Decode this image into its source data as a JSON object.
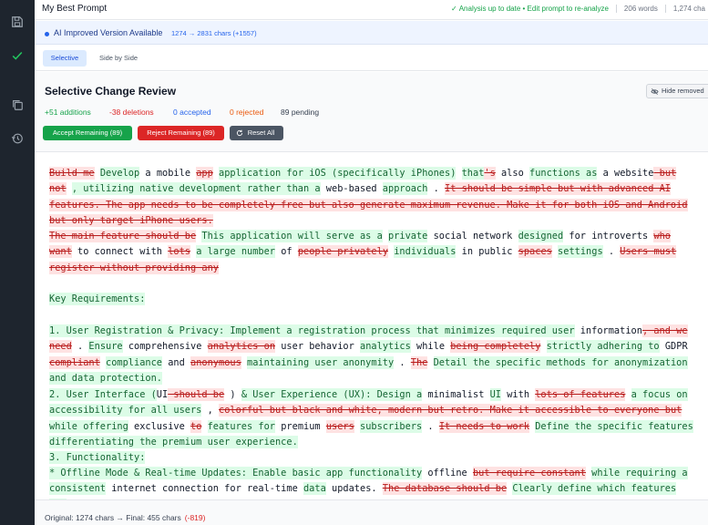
{
  "app": {
    "title": "My Best Prompt"
  },
  "header": {
    "status": "Analysis up to date • Edit prompt to re-analyze",
    "words": "206 words",
    "chars": "1,274 cha"
  },
  "banner": {
    "label": "AI Improved Version Available",
    "delta": "1274 → 2831 chars (+1557)"
  },
  "tabs": [
    {
      "label": "Selective",
      "active": true
    },
    {
      "label": "Side by Side",
      "active": false
    }
  ],
  "review": {
    "title": "Selective Change Review",
    "hide_removed": "Hide removed",
    "stats": {
      "additions": "+51 additions",
      "deletions": "-38 deletions",
      "accepted": "0 accepted",
      "rejected": "0 rejected",
      "pending": "89 pending"
    },
    "buttons": {
      "accept": "Accept Remaining (89)",
      "reject": "Reject Remaining (89)",
      "reset": "Reset All"
    }
  },
  "diff": [
    [
      [
        "del",
        "Build me"
      ],
      [
        "",
        " "
      ],
      [
        "add",
        "Develop"
      ],
      [
        "",
        " a mobile "
      ],
      [
        "del",
        "app"
      ],
      [
        "",
        " "
      ],
      [
        "add",
        "application for iOS (specifically iPhones)"
      ],
      [
        "",
        " "
      ],
      [
        "add",
        "that"
      ],
      [
        "del",
        "'s"
      ],
      [
        "",
        " also "
      ],
      [
        "add",
        "functions as"
      ],
      [
        "",
        " a website"
      ],
      [
        "del",
        " but not"
      ],
      [
        "",
        " "
      ],
      [
        "add",
        ", utilizing native development rather than a"
      ],
      [
        "",
        " web-based "
      ],
      [
        "add",
        "approach"
      ],
      [
        "",
        " . "
      ],
      [
        "del",
        "It should be simple but with advanced AI features. The app needs to be completely free but also generate maximum revenue. Make it for both iOS and Android but only target iPhone users."
      ]
    ],
    [
      [
        "del",
        "The main feature should be"
      ],
      [
        "",
        " "
      ],
      [
        "add",
        "This application will serve as a"
      ],
      [
        "",
        " "
      ],
      [
        "add",
        "private"
      ],
      [
        "",
        " social network "
      ],
      [
        "add",
        "designed"
      ],
      [
        "",
        " for introverts "
      ],
      [
        "del",
        "who want"
      ],
      [
        "",
        " to connect with "
      ],
      [
        "del",
        "lots"
      ],
      [
        "",
        " "
      ],
      [
        "add",
        "a large number"
      ],
      [
        "",
        " of "
      ],
      [
        "del",
        "people privately"
      ],
      [
        "",
        " "
      ],
      [
        "add",
        "individuals"
      ],
      [
        "",
        " in public "
      ],
      [
        "del",
        "spaces"
      ],
      [
        "",
        " "
      ],
      [
        "add",
        "settings"
      ],
      [
        "",
        " . "
      ],
      [
        "del",
        "Users must register without providing any"
      ]
    ],
    [
      [
        "add",
        "Key Requirements:"
      ]
    ],
    [
      [
        "add",
        "1.  User Registration & Privacy: Implement a registration process that minimizes required user"
      ],
      [
        "",
        " information"
      ],
      [
        "del",
        ", and we need"
      ],
      [
        "",
        " . "
      ],
      [
        "add",
        "Ensure"
      ],
      [
        "",
        " comprehensive "
      ],
      [
        "del",
        "analytics on"
      ],
      [
        "",
        " user behavior "
      ],
      [
        "add",
        "analytics"
      ],
      [
        "",
        " while "
      ],
      [
        "del",
        "being completely"
      ],
      [
        "",
        " "
      ],
      [
        "add",
        "strictly adhering to"
      ],
      [
        "",
        " GDPR "
      ],
      [
        "del",
        "compliant"
      ],
      [
        "",
        " "
      ],
      [
        "add",
        "compliance"
      ],
      [
        "",
        " and "
      ],
      [
        "del",
        "anonymous"
      ],
      [
        "",
        " "
      ],
      [
        "add",
        "maintaining user anonymity"
      ],
      [
        "",
        " . "
      ],
      [
        "del",
        "The"
      ],
      [
        "",
        " "
      ],
      [
        "add",
        " Detail the specific methods for anonymization and data protection."
      ]
    ],
    [
      [
        "add",
        "2.  User Interface ("
      ],
      [
        "",
        "UI"
      ],
      [
        "del",
        " should be"
      ],
      [
        "",
        " ) "
      ],
      [
        "add",
        "& User Experience (UX): Design a"
      ],
      [
        "",
        " minimalist "
      ],
      [
        "add",
        "UI"
      ],
      [
        "",
        " with "
      ],
      [
        "del",
        "lots of features"
      ],
      [
        "",
        " "
      ],
      [
        "add",
        "a focus on accessibility for all users"
      ],
      [
        "",
        " , "
      ],
      [
        "del",
        "colorful but black and white, modern but retro. Make it accessible to everyone but"
      ],
      [
        "",
        " "
      ],
      [
        "add",
        "while offering"
      ],
      [
        "",
        " exclusive "
      ],
      [
        "del",
        "to"
      ],
      [
        "",
        " "
      ],
      [
        "add",
        "features for"
      ],
      [
        "",
        " premium "
      ],
      [
        "del",
        "users"
      ],
      [
        "",
        " "
      ],
      [
        "add",
        "subscribers"
      ],
      [
        "",
        " . "
      ],
      [
        "del",
        "It needs to work"
      ],
      [
        "",
        " "
      ],
      [
        "add",
        " Define the specific features differentiating the premium user experience."
      ]
    ],
    [
      [
        "add",
        "3.  Functionality:"
      ]
    ],
    [
      [
        "add",
        "    *   Offline Mode & Real-time Updates: Enable basic app functionality"
      ],
      [
        "",
        " offline "
      ],
      [
        "del",
        "but require constant"
      ],
      [
        "",
        " "
      ],
      [
        "add",
        "while requiring a consistent"
      ],
      [
        "",
        " internet connection for real-time "
      ],
      [
        "add",
        "data"
      ],
      [
        "",
        " updates. "
      ],
      [
        "del",
        "The database should be"
      ],
      [
        "",
        " "
      ],
      [
        "add",
        "Clearly define which features are"
      ]
    ]
  ],
  "footer": {
    "summary": "Original: 1274 chars → Final: 455 chars",
    "delta": "(-819)"
  }
}
